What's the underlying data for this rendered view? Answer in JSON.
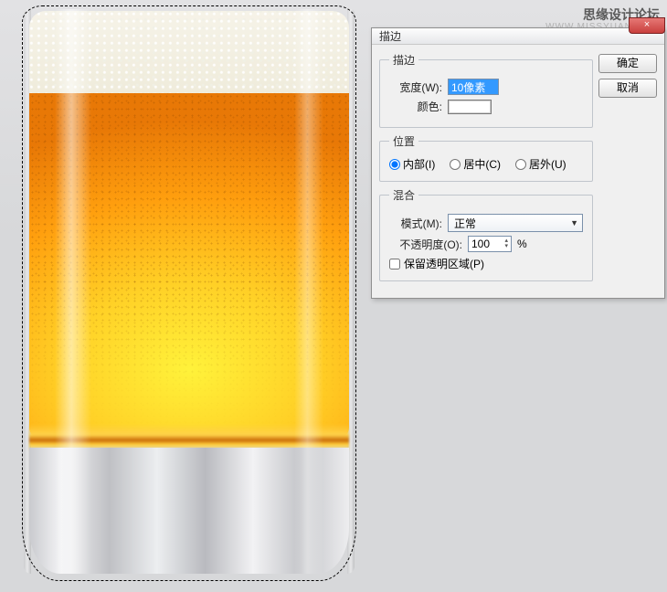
{
  "watermark": {
    "title": "思缘设计论坛",
    "url": "WWW.MISSYUAN.COM"
  },
  "dialog": {
    "title": "描边",
    "close_label": "×",
    "buttons": {
      "ok": "确定",
      "cancel": "取消"
    },
    "stroke_group": {
      "legend": "描边",
      "width_label": "宽度(W):",
      "width_value": "10像素",
      "color_label": "颜色:",
      "color_value": "#ffffff"
    },
    "position_group": {
      "legend": "位置",
      "options": {
        "inside": "内部(I)",
        "center": "居中(C)",
        "outside": "居外(U)"
      },
      "selected": "inside"
    },
    "blend_group": {
      "legend": "混合",
      "mode_label": "模式(M):",
      "mode_value": "正常",
      "opacity_label": "不透明度(O):",
      "opacity_value": "100",
      "opacity_unit": "%",
      "preserve_label": "保留透明区域(P)",
      "preserve_checked": false
    }
  }
}
